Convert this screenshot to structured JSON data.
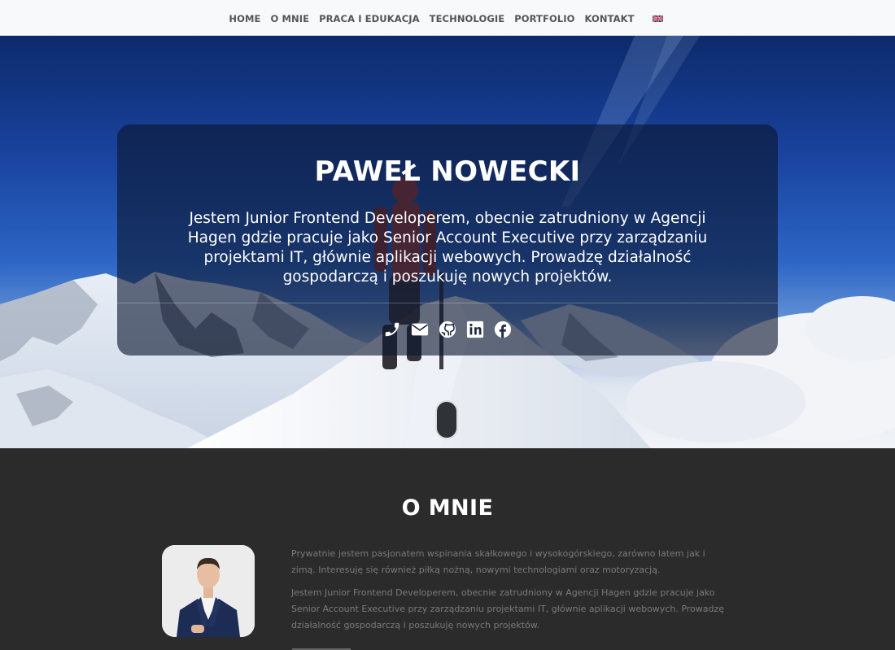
{
  "nav": {
    "items": [
      {
        "label": "HOME"
      },
      {
        "label": "O MNIE"
      },
      {
        "label": "PRACA I EDUKACJA"
      },
      {
        "label": "TECHNOLOGIE"
      },
      {
        "label": "PORTFOLIO"
      },
      {
        "label": "KONTAKT"
      }
    ],
    "language_icon": "uk-flag-icon"
  },
  "hero": {
    "name": "PAWEŁ NOWECKI",
    "text": "Jestem Junior Frontend Developerem, obecnie zatrudniony w Agencji Hagen gdzie pracuje jako Senior Account Executive przy zarządzaniu projektami IT, głównie aplikacji webowych. Prowadzę działalność gospodarczą i poszukuję nowych projektów.",
    "social_icons": [
      "phone-icon",
      "envelope-icon",
      "github-icon",
      "linkedin-icon",
      "facebook-icon"
    ]
  },
  "about": {
    "title": "O MNIE",
    "paragraph1": "Prywatnie jestem pasjonatem wspinania skałkowego i wysokogórskiego, zarówno latem jak i zimą. Interesuję się również piłką nożną, nowymi technologiami oraz motoryzacją.",
    "paragraph2": "Jestem Junior Frontend Developerem, obecnie zatrudniony w Agencji Hagen gdzie pracuje jako Senior Account Executive przy zarządzaniu projektami IT, głównie aplikacji webowych. Prowadzę działalność gospodarczą i poszukuję nowych projektów."
  },
  "colors": {
    "nav_bg": "#f8f9fa",
    "nav_text": "#555555",
    "dark_section": "#2b2b2b",
    "hero_overlay": "rgba(12,22,48,0.62)"
  }
}
